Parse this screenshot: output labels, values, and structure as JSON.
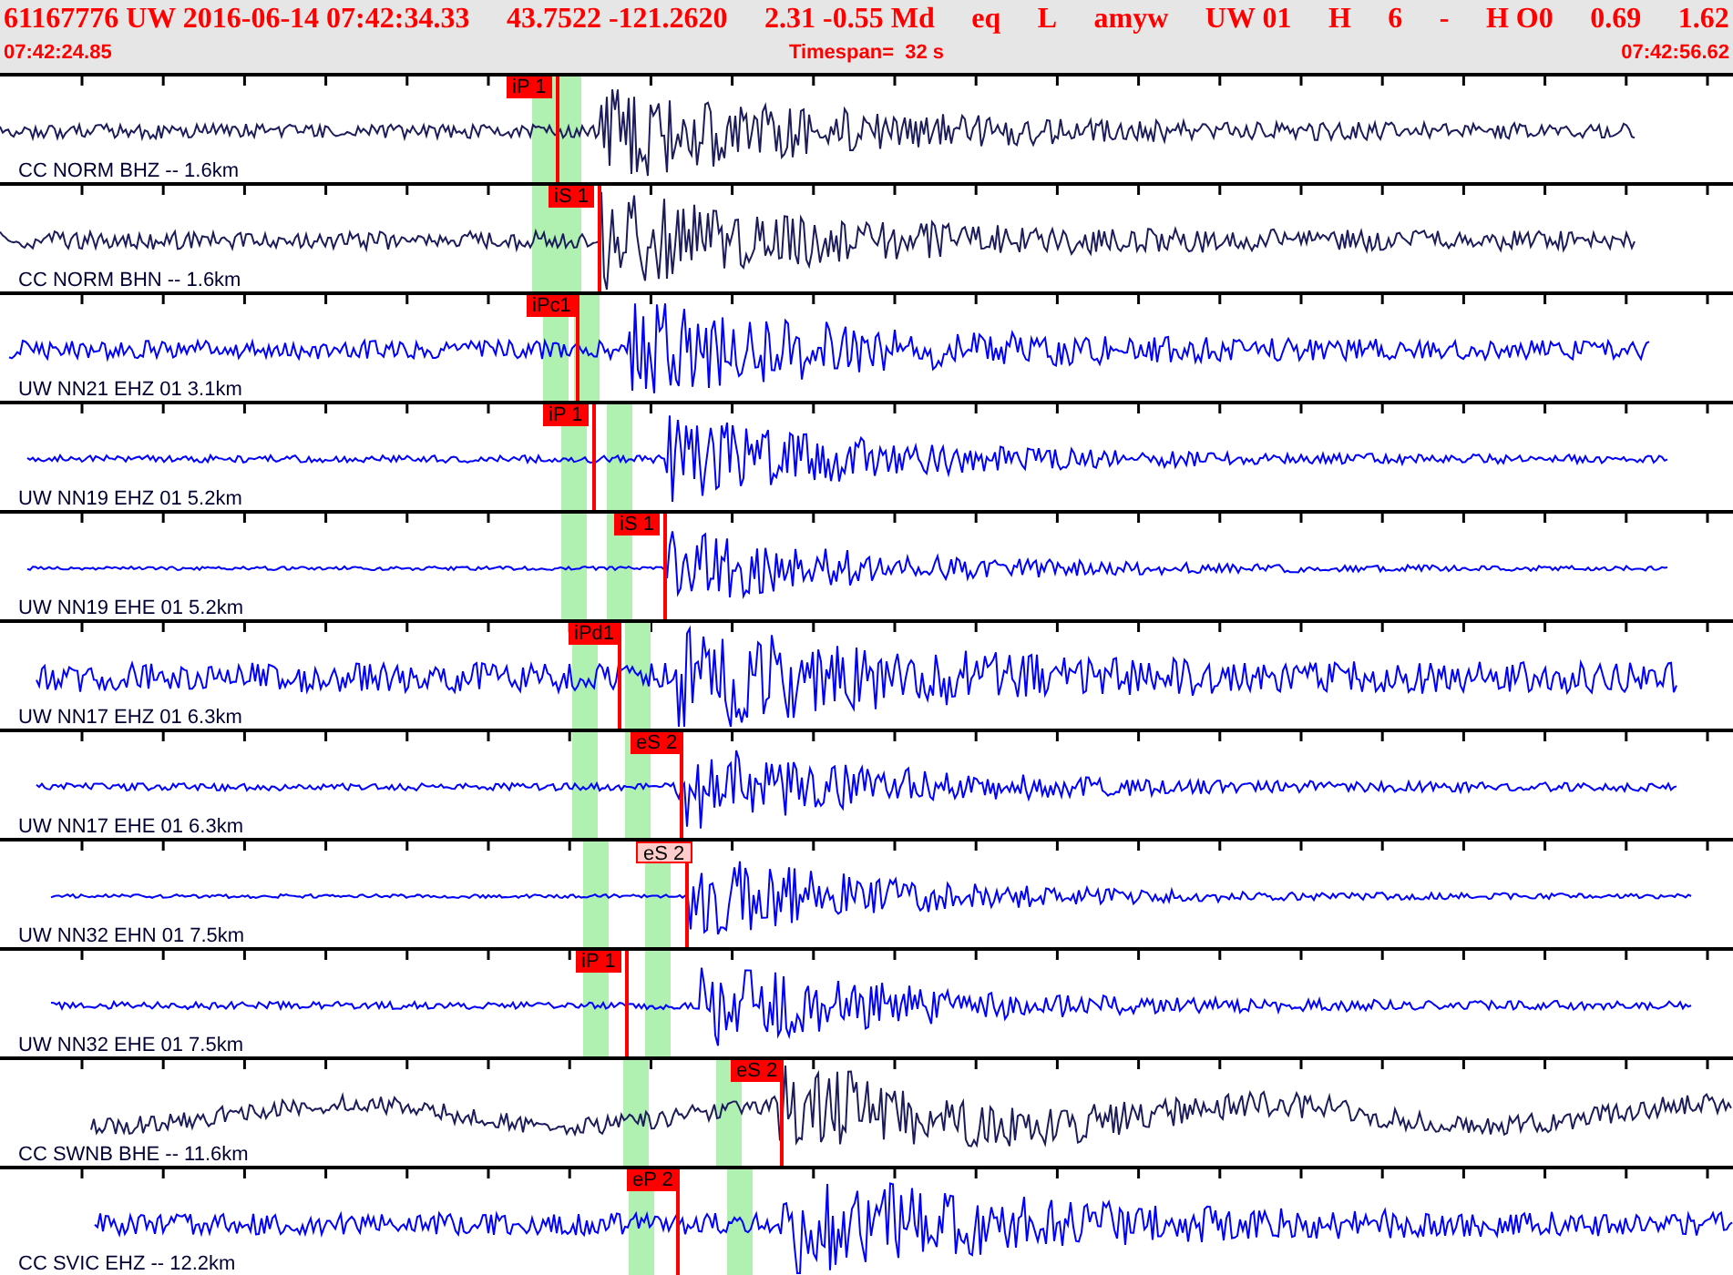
{
  "header": {
    "fields": [
      "61167776 UW 2016-06-14 07:42:34.33",
      "43.7522 -121.2620",
      "2.31 -0.55 Md",
      "eq",
      "L",
      "amyw",
      "UW 01",
      "H",
      "6",
      "-",
      "H O0",
      "0.69",
      "1.62"
    ],
    "start_time": "07:42:24.85",
    "timespan": "Timespan=  32 s",
    "end_time": "07:42:56.62"
  },
  "traces": [
    {
      "label": "CC NORM BHZ -- 1.6km",
      "color": "#1c1c5c",
      "picks": [
        {
          "label": "iP 1",
          "muted": false
        }
      ]
    },
    {
      "label": "CC NORM BHN -- 1.6km",
      "color": "#1c1c5c",
      "picks": [
        {
          "label": "iS 1",
          "muted": false
        }
      ]
    },
    {
      "label": "UW NN21 EHZ 01 3.1km",
      "color": "#0000ff",
      "picks": [
        {
          "label": "iPc1",
          "muted": false
        }
      ]
    },
    {
      "label": "UW NN19 EHZ 01 5.2km",
      "color": "#0000ff",
      "picks": [
        {
          "label": "iP 1",
          "muted": false
        }
      ]
    },
    {
      "label": "UW NN19 EHE 01 5.2km",
      "color": "#0000ff",
      "picks": [
        {
          "label": "iS 1",
          "muted": false
        }
      ]
    },
    {
      "label": "UW NN17 EHZ 01 6.3km",
      "color": "#0000ff",
      "picks": [
        {
          "label": "iPd1",
          "muted": false
        }
      ]
    },
    {
      "label": "UW NN17 EHE 01 6.3km",
      "color": "#0000ff",
      "picks": [
        {
          "label": "eS 2",
          "muted": false
        }
      ]
    },
    {
      "label": "UW NN32 EHN 01 7.5km",
      "color": "#0000ff",
      "picks": [
        {
          "label": "eS 2",
          "muted": true
        }
      ]
    },
    {
      "label": "UW NN32 EHE 01 7.5km",
      "color": "#0000ff",
      "picks": [
        {
          "label": "iP 1",
          "muted": false
        }
      ]
    },
    {
      "label": "CC SWNB BHE -- 11.6km",
      "color": "#1c1c5c",
      "picks": [
        {
          "label": "eS 2",
          "muted": false
        }
      ]
    },
    {
      "label": "CC SVIC EHZ -- 12.2km",
      "color": "#0000ff",
      "picks": [
        {
          "label": "eP 2",
          "muted": false
        }
      ]
    }
  ]
}
